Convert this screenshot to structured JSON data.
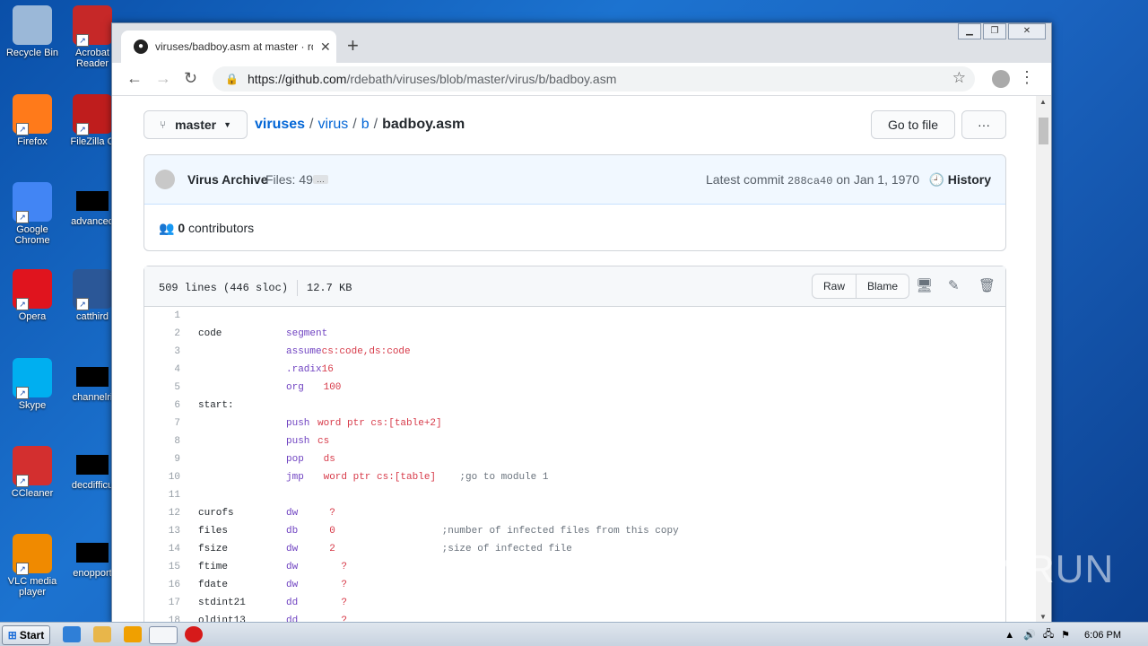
{
  "desktop": {
    "icons": [
      {
        "label": "Recycle Bin",
        "icon": "recycle-bin-icon",
        "color": "#9bb8d8"
      },
      {
        "label": "Acrobat Reader",
        "icon": "acrobat-icon",
        "color": "#c62828"
      },
      {
        "label": "Firefox",
        "icon": "firefox-icon",
        "color": "#ff7a1a"
      },
      {
        "label": "FileZilla C",
        "icon": "filezilla-icon",
        "color": "#bf1d1d"
      },
      {
        "label": "Google Chrome",
        "icon": "chrome-icon",
        "color": "#4285f4"
      },
      {
        "label": "advanced",
        "icon": "file-icon",
        "color": "#000000"
      },
      {
        "label": "Opera",
        "icon": "opera-icon",
        "color": "#e0141e"
      },
      {
        "label": "catthird",
        "icon": "word-doc-icon",
        "color": "#2b5797"
      },
      {
        "label": "Skype",
        "icon": "skype-icon",
        "color": "#00aff0"
      },
      {
        "label": "channelri",
        "icon": "file-icon",
        "color": "#000000"
      },
      {
        "label": "CCleaner",
        "icon": "ccleaner-icon",
        "color": "#d32f2f"
      },
      {
        "label": "decdifficu",
        "icon": "file-icon",
        "color": "#000000"
      },
      {
        "label": "VLC media player",
        "icon": "vlc-icon",
        "color": "#f08a00"
      },
      {
        "label": "enopport",
        "icon": "file-icon",
        "color": "#000000"
      }
    ]
  },
  "browser": {
    "tab_title": "viruses/badboy.asm at master · rdebath/viruses",
    "tab_close": "✕",
    "new_tab": "+",
    "url_host": "https://github.com",
    "url_path": "/rdebath/viruses/blob/master/virus/b/badboy.asm"
  },
  "repo": {
    "branch": "master",
    "crumbs": [
      "viruses",
      "virus",
      "b"
    ],
    "file": "badboy.asm",
    "go_to_file": "Go to file",
    "more": "···"
  },
  "commit": {
    "author": "Virus Archive",
    "message": "Files: 49",
    "ellipsis": "…",
    "latest_prefix": "Latest commit",
    "sha": "288ca40",
    "date": "on Jan 1, 1970",
    "history": "History",
    "contributors_count": "0",
    "contributors_label": "contributors"
  },
  "file": {
    "lines_info": "509 lines (446 sloc)",
    "size": "12.7 KB",
    "raw": "Raw",
    "blame": "Blame"
  },
  "code_lines": [
    {
      "n": "1",
      "label": "",
      "op": "",
      "args": "",
      "comment": ""
    },
    {
      "n": "2",
      "label": "code",
      "op": "segment",
      "args": "",
      "comment": ""
    },
    {
      "n": "3",
      "label": "",
      "op": "assume",
      "args": "cs:code,ds:code",
      "comment": ""
    },
    {
      "n": "4",
      "label": "",
      "op": ".radix",
      "args": "16",
      "comment": ""
    },
    {
      "n": "5",
      "label": "",
      "op": "org",
      "args": " 100",
      "comment": ""
    },
    {
      "n": "6",
      "label": "start:",
      "op": "",
      "args": "",
      "comment": ""
    },
    {
      "n": "7",
      "label": "",
      "op": "push",
      "args": "word ptr cs:[table+2]",
      "comment": ""
    },
    {
      "n": "8",
      "label": "",
      "op": "push",
      "args": "cs",
      "comment": ""
    },
    {
      "n": "9",
      "label": "",
      "op": "pop",
      "args": " ds",
      "comment": ""
    },
    {
      "n": "10",
      "label": "",
      "op": "jmp",
      "args": " word ptr cs:[table]",
      "comment": "    ;go to module 1"
    },
    {
      "n": "11",
      "label": "",
      "op": "",
      "args": "",
      "comment": ""
    },
    {
      "n": "12",
      "label": "curofs",
      "op": "dw",
      "args": "  ?",
      "comment": ""
    },
    {
      "n": "13",
      "label": "files",
      "op": "db",
      "args": "  0",
      "comment": "                  ;number of infected files from this copy"
    },
    {
      "n": "14",
      "label": "fsize",
      "op": "dw",
      "args": "  2",
      "comment": "                  ;size of infected file"
    },
    {
      "n": "15",
      "label": "ftime",
      "op": "dw",
      "args": "    ?",
      "comment": ""
    },
    {
      "n": "16",
      "label": "fdate",
      "op": "dw",
      "args": "    ?",
      "comment": ""
    },
    {
      "n": "17",
      "label": "stdint21",
      "op": "dd",
      "args": "    ?",
      "comment": ""
    },
    {
      "n": "18",
      "label": "oldint13",
      "op": "dd",
      "args": "    ?",
      "comment": ""
    }
  ],
  "taskbar": {
    "start_label": "Start",
    "clock": "6:06 PM"
  },
  "watermark": "ANY RUN"
}
